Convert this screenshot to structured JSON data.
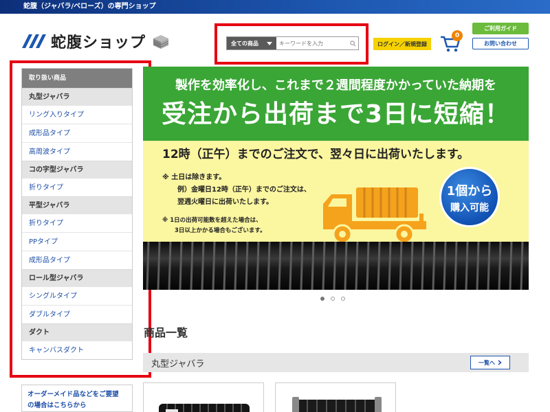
{
  "topbar": {
    "text": "蛇腹（ジャバラ/ベローズ）の専門ショップ"
  },
  "logo": {
    "name": "蛇腹ショップ"
  },
  "search": {
    "category": "全ての商品",
    "placeholder": "キーワードを入力",
    "value": ""
  },
  "header": {
    "login_label": "ログイン／新規登録",
    "cart_count": "0",
    "guide_label": "ご利用ガイド",
    "contact_label": "お問い合わせ"
  },
  "sidebar": {
    "heading": "取り扱い商品",
    "groups": [
      {
        "label": "丸型ジャバラ",
        "items": [
          "リング入りタイプ",
          "成形品タイプ",
          "高周波タイプ"
        ]
      },
      {
        "label": "コの字型ジャバラ",
        "items": [
          "折りタイプ"
        ]
      },
      {
        "label": "平型ジャバラ",
        "items": [
          "折りタイプ",
          "PPタイプ",
          "成形品タイプ"
        ]
      },
      {
        "label": "ロール型ジャバラ",
        "items": [
          "シングルタイプ",
          "ダブルタイプ"
        ]
      },
      {
        "label": "ダクト",
        "items": [
          "キャンバスダクト"
        ]
      }
    ]
  },
  "order_box": {
    "line1": "オーダーメイド品などをご要望",
    "line2": "の場合はこちらから"
  },
  "banner": {
    "line1": "製作を効率化し、これまで２週間程度かかっていた納期を",
    "line2": "受注から出荷まで3日に短縮！",
    "line3": "12時（正午）までのご注文で、翌々日に出荷いたします。",
    "note1": "※ 土日は除きます。",
    "note2": "例）金曜日12時（正午）までのご注文は、",
    "note3": "翌週火曜日に出荷いたします。",
    "note4": "※ 1日の出荷可能数を超えた場合は、",
    "note5": "3日以上かかる場合もございます。",
    "seal_line1": "1個から",
    "seal_line2": "購入可能"
  },
  "carousel": {
    "count": 3,
    "active": 0
  },
  "products": {
    "title": "商品一覧",
    "category": "丸型ジャバラ",
    "more_label": "一覧へ"
  },
  "colors": {
    "accent_blue": "#1d57b0",
    "highlight_red": "#e60012",
    "banner_green": "#3aa636",
    "login_yellow": "#f5d200",
    "badge_orange": "#f08300"
  }
}
